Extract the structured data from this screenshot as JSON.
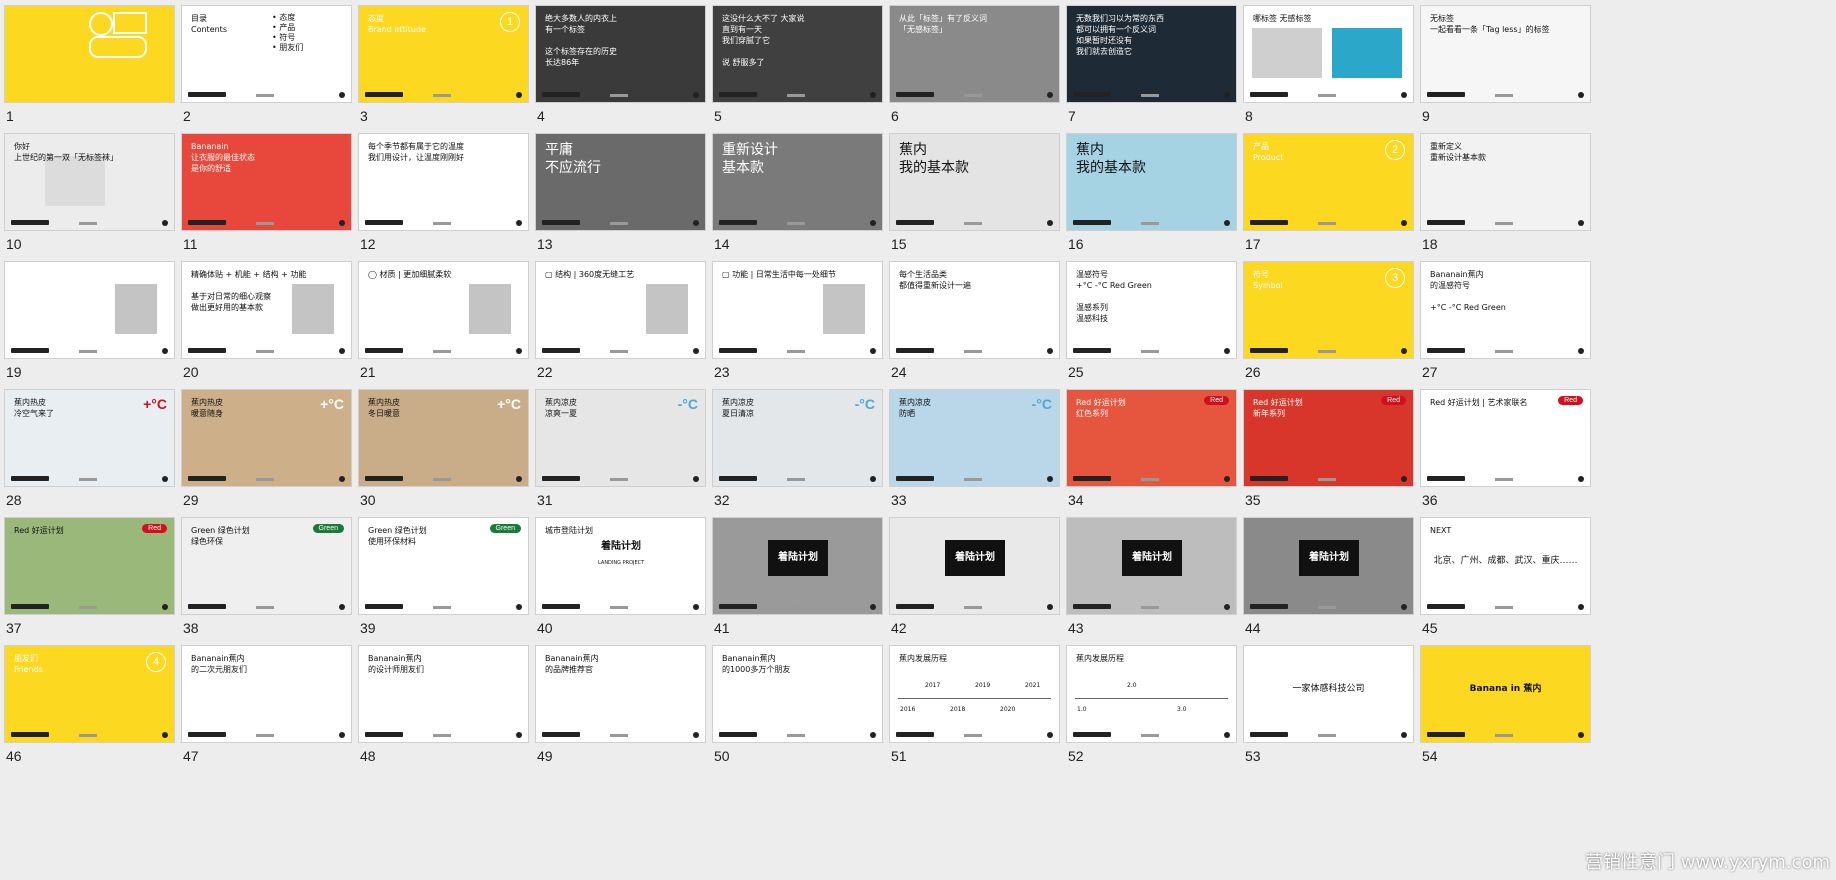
{
  "watermark": "营销性意门 www.yxrym.com",
  "colors": {
    "yellow": "#fcd821",
    "red": "#d0101c",
    "green": "#1a7a3a",
    "blue": "#4ba9d6"
  },
  "slides": [
    {
      "n": "1",
      "bg": "#fcd821",
      "icon": "yellow-logo"
    },
    {
      "n": "2",
      "bg": "#ffffff",
      "text": "目录\nContents",
      "list": [
        "态度",
        "产品",
        "符号",
        "朋友们"
      ]
    },
    {
      "n": "3",
      "bg": "#fcd821",
      "text": "态度\nBrand attitude",
      "circle": "1",
      "tone": "white"
    },
    {
      "n": "4",
      "bg": "#3a3a3a",
      "text": "绝大多数人的内衣上\n有一个标签\n\n这个标签存在的历史\n长达86年",
      "tone": "white"
    },
    {
      "n": "5",
      "bg": "#404040",
      "text": "这没什么大不了 大家说\n直到有一天\n我们穿腻了它\n\n说 舒服多了",
      "tone": "white"
    },
    {
      "n": "6",
      "bg": "#8a8a8a",
      "text": "从此「标签」有了反义词\n「无感标签」",
      "tone": "white"
    },
    {
      "n": "7",
      "bg": "#1e2a36",
      "text": "无数我们习以为常的东西\n都可以拥有一个反义词\n如果暂时还没有\n我们就去创造它",
      "tone": "white"
    },
    {
      "n": "8",
      "bg": "#ffffff",
      "text": "哪标签            无感标签",
      "photo": [
        "#cfcfcf",
        "#2aa7c9"
      ]
    },
    {
      "n": "9",
      "bg": "#f6f6f6",
      "text": "无标签\n一起看看一条「Tag less」的标签"
    },
    {
      "n": "10",
      "bg": "#ececec",
      "text": "你好\n上世纪的第一双「无标签袜」",
      "photo": [
        "#dcdcdc"
      ]
    },
    {
      "n": "11",
      "bg": "#e8483c",
      "text": "Bananain\n让衣服的最佳状态\n是你的舒适",
      "tone": "white"
    },
    {
      "n": "12",
      "bg": "#ffffff",
      "text": "每个季节都有属于它的温度\n我们用设计，让温度刚刚好"
    },
    {
      "n": "13",
      "bg": "#6a6a6a",
      "text": "平庸\n不应流行",
      "tone": "white",
      "big": true
    },
    {
      "n": "14",
      "bg": "#7a7a7a",
      "text": "重新设计\n基本款",
      "tone": "white",
      "big": true
    },
    {
      "n": "15",
      "bg": "#e4e4e4",
      "text": "蕉内\n我的基本款",
      "big": true
    },
    {
      "n": "16",
      "bg": "#a6d3e3",
      "text": "蕉内\n我的基本款",
      "big": true
    },
    {
      "n": "17",
      "bg": "#fcd821",
      "text": "产品\nProduct",
      "circle": "2",
      "tone": "white"
    },
    {
      "n": "18",
      "bg": "#f2f2f2",
      "text": "重新定义\n重新设计基本款"
    },
    {
      "n": "19",
      "bg": "#ffffff",
      "photo": [
        "#c4c4c4"
      ]
    },
    {
      "n": "20",
      "bg": "#ffffff",
      "text": "精确体贴 + 机能 + 结构 + 功能\n\n基于对日常的细心观察\n做出更好用的基本款",
      "photo": [
        "#c4c4c4"
      ]
    },
    {
      "n": "21",
      "bg": "#ffffff",
      "text": "◯  材质 | 更加细腻柔软",
      "photo": [
        "#c4c4c4"
      ]
    },
    {
      "n": "22",
      "bg": "#ffffff",
      "text": "▢  结构 | 360度无缝工艺",
      "photo": [
        "#c4c4c4"
      ]
    },
    {
      "n": "23",
      "bg": "#ffffff",
      "text": "▢  功能 | 日常生活中每一处细节",
      "photo": [
        "#c4c4c4"
      ]
    },
    {
      "n": "24",
      "bg": "#ffffff",
      "text": "每个生活品类\n都值得重新设计一遍"
    },
    {
      "n": "25",
      "bg": "#ffffff",
      "text": "温感符号\n+°C  -°C  Red  Green\n\n温感系列\n温感科技"
    },
    {
      "n": "26",
      "bg": "#fcd821",
      "text": "符号\nSymbol",
      "circle": "3",
      "tone": "white"
    },
    {
      "n": "27",
      "bg": "#ffffff",
      "text": "Bananain蕉内\n的温感符号\n\n+°C     -°C     Red     Green"
    },
    {
      "n": "28",
      "bg": "#e9eef3",
      "text": "蕉内热皮\n冷空气来了",
      "tag": "+°C",
      "tagColor": "#d0101c"
    },
    {
      "n": "29",
      "bg": "#cdb08a",
      "text": "蕉内热皮\n暖意随身",
      "tag": "+°C",
      "tagColor": "#ffffff"
    },
    {
      "n": "30",
      "bg": "#c9ad88",
      "text": "蕉内热皮\n冬日暖意",
      "tag": "+°C",
      "tagColor": "#ffffff"
    },
    {
      "n": "31",
      "bg": "#e6e6e6",
      "text": "蕉内凉皮\n凉爽一夏",
      "tag": "-°C",
      "tagColor": "#4ba9d6"
    },
    {
      "n": "32",
      "bg": "#e3e7ea",
      "text": "蕉内凉皮\n夏日清凉",
      "tag": "-°C",
      "tagColor": "#4ba9d6"
    },
    {
      "n": "33",
      "bg": "#b9d7e8",
      "text": "蕉内凉皮\n防晒",
      "tag": "-°C",
      "tagColor": "#4ba9d6"
    },
    {
      "n": "34",
      "bg": "#e6553d",
      "text": "Red 好运计划\n红色系列",
      "pill": "Red",
      "pillColor": "#d0101c",
      "tone": "white"
    },
    {
      "n": "35",
      "bg": "#d8362b",
      "text": "Red 好运计划\n新年系列",
      "pill": "Red",
      "pillColor": "#d0101c",
      "tone": "white"
    },
    {
      "n": "36",
      "bg": "#ffffff",
      "text": "Red 好运计划 | 艺术家联名",
      "pill": "Red",
      "pillColor": "#d0101c"
    },
    {
      "n": "37",
      "bg": "#9bb87b",
      "text": "Red 好运计划",
      "pill": "Red",
      "pillColor": "#d0101c"
    },
    {
      "n": "38",
      "bg": "#efefef",
      "text": "Green 绿色计划\n绿色环保",
      "pill": "Green",
      "pillColor": "#1a7a3a"
    },
    {
      "n": "39",
      "bg": "#ffffff",
      "text": "Green 绿色计划\n使用环保材料",
      "pill": "Green",
      "pillColor": "#1a7a3a"
    },
    {
      "n": "40",
      "bg": "#ffffff",
      "text": "城市登陆计划",
      "logo": "着陆计划",
      "sub": "LANDING PROJECT"
    },
    {
      "n": "41",
      "bg": "#9a9a9a",
      "logo": "着陆计划"
    },
    {
      "n": "42",
      "bg": "#e9e9e9",
      "logo": "着陆计划"
    },
    {
      "n": "43",
      "bg": "#bdbdbd",
      "logo": "着陆计划"
    },
    {
      "n": "44",
      "bg": "#8a8a8a",
      "logo": "着陆计划"
    },
    {
      "n": "45",
      "bg": "#ffffff",
      "text": "NEXT",
      "center": "北京、广州、成都、武汉、重庆……"
    },
    {
      "n": "46",
      "bg": "#fcd821",
      "text": "朋友们\nFriends",
      "circle": "4",
      "tone": "white"
    },
    {
      "n": "47",
      "bg": "#ffffff",
      "text": "Bananain蕉内\n的二次元朋友们"
    },
    {
      "n": "48",
      "bg": "#ffffff",
      "text": "Bananain蕉内\n的设计师朋友们"
    },
    {
      "n": "49",
      "bg": "#ffffff",
      "text": "Bananain蕉内\n的品牌推荐官"
    },
    {
      "n": "50",
      "bg": "#ffffff",
      "text": "Bananain蕉内\n的1000多万个朋友"
    },
    {
      "n": "51",
      "bg": "#ffffff",
      "text": "蕉内发展历程",
      "years": [
        "2016",
        "2017",
        "2018",
        "2019",
        "2020",
        "2021"
      ]
    },
    {
      "n": "52",
      "bg": "#ffffff",
      "text": "蕉内发展历程",
      "years": [
        "1.0",
        "2.0",
        "3.0"
      ]
    },
    {
      "n": "53",
      "bg": "#ffffff",
      "center": "一家体感科技公司"
    },
    {
      "n": "54",
      "bg": "#fcd821",
      "center": "Banana in 蕉内",
      "dark": true
    }
  ]
}
